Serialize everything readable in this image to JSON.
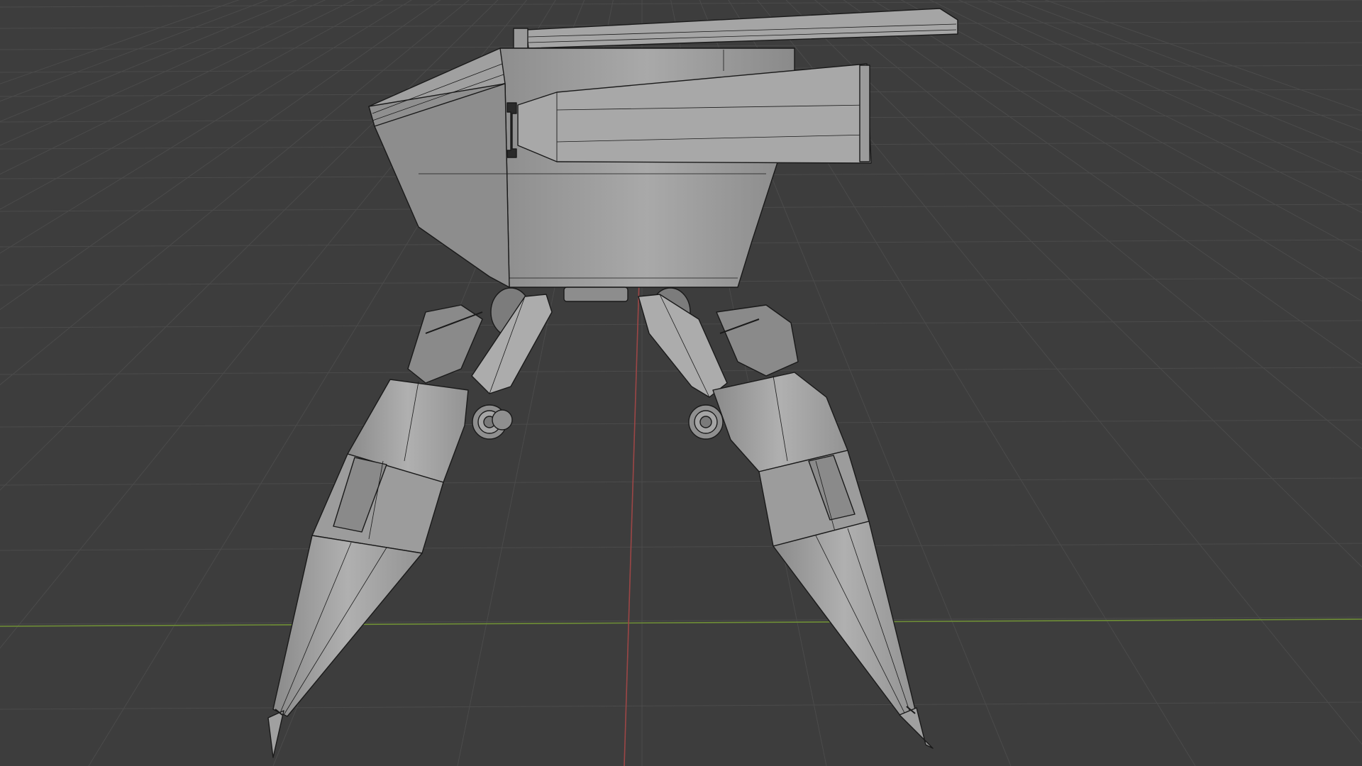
{
  "app": {
    "name": "3D Viewport"
  },
  "viewport": {
    "background_color": "#3d3d3d",
    "grid_color": "#4b4b4b",
    "x_axis_color": "#7a9a3a",
    "y_axis_color": "#a34a4a",
    "shading": "solid",
    "overlay": "wireframe"
  },
  "model": {
    "description_icon": "tripod-mech-icon",
    "parts": [
      "turret-body",
      "cannon-barrel",
      "top-rail",
      "left-leg",
      "right-leg",
      "hip-joint-left",
      "hip-joint-right",
      "foot-spike-left",
      "foot-spike-right"
    ],
    "fill_light": "#b4b4b4",
    "fill_mid": "#9a9a9a",
    "fill_dark": "#7c7c7c",
    "edge_color": "#1a1a1a"
  }
}
